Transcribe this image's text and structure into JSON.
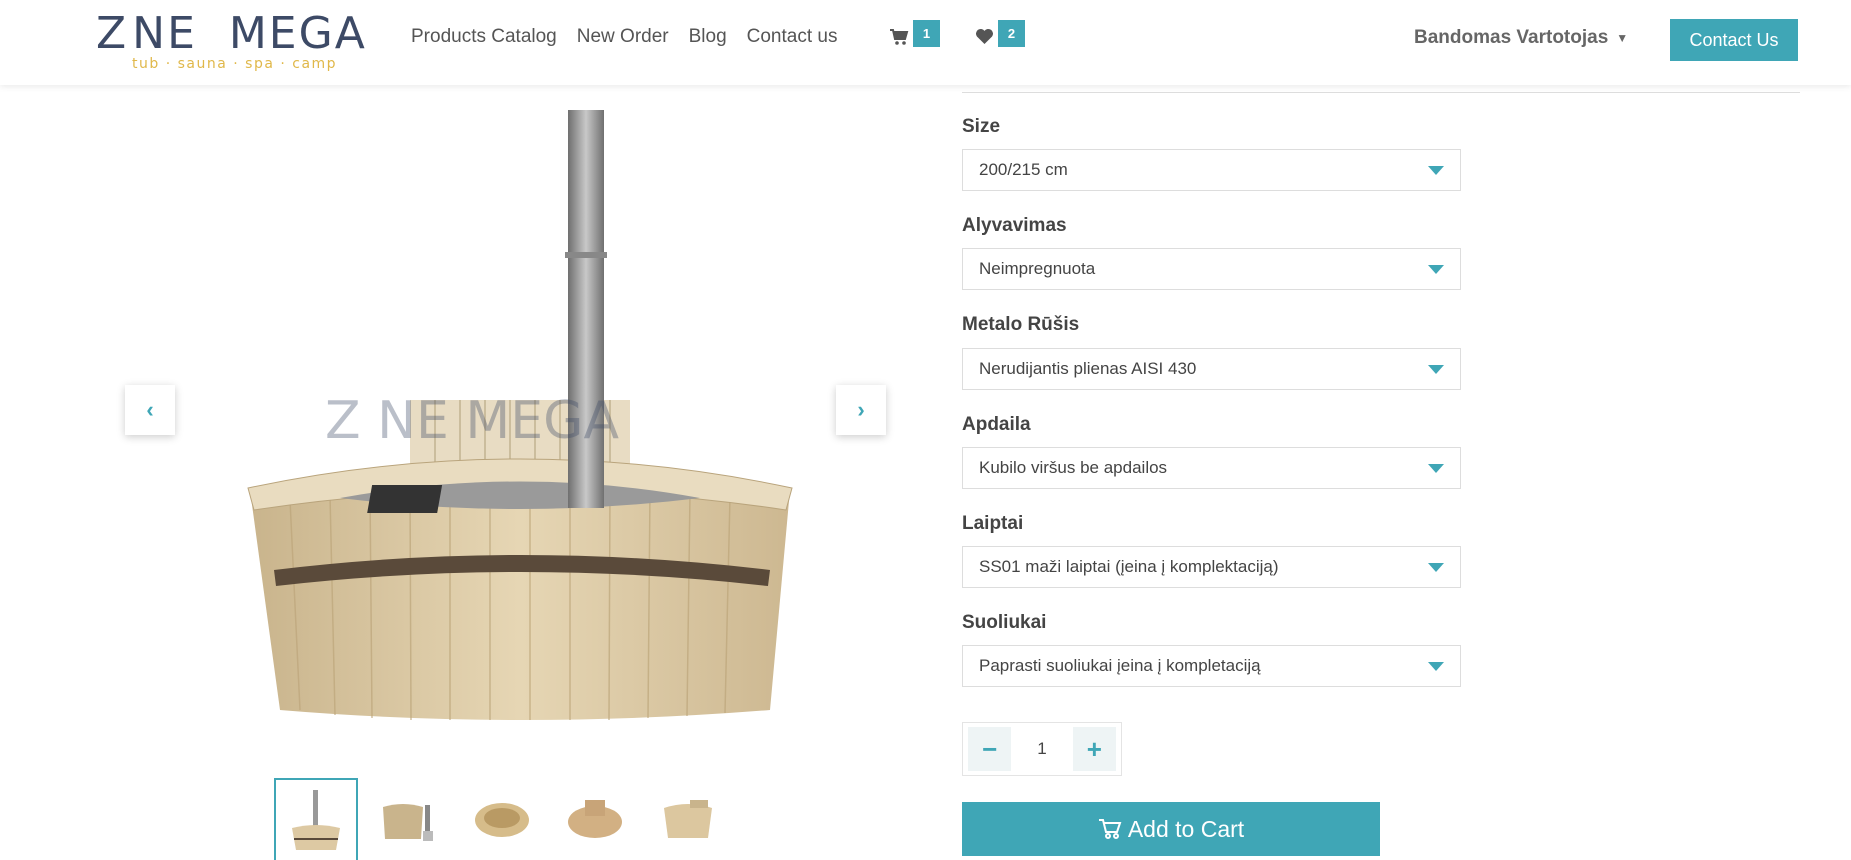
{
  "brand": {
    "logo_name": "ZONE MEGA",
    "tagline": "tub · sauna · spa · camp",
    "colors": {
      "accent": "#3fa6b6",
      "logo_text": "#3d4a66",
      "tagline": "#e0b84a"
    }
  },
  "nav": {
    "items": [
      {
        "label": "Products Catalog"
      },
      {
        "label": "New Order"
      },
      {
        "label": "Blog"
      },
      {
        "label": "Contact us"
      }
    ],
    "cart_count": "1",
    "wishlist_count": "2",
    "user_name": "Bandomas Vartotojas",
    "contact_button": "Contact Us"
  },
  "gallery": {
    "thumbnails": [
      "hot tub with stove",
      "hot tub side",
      "wooden tub open",
      "tub with bench",
      "round wooden tub"
    ]
  },
  "options": [
    {
      "label": "Size",
      "value": "200/215 cm"
    },
    {
      "label": "Alyvavimas",
      "value": "Neimpregnuota"
    },
    {
      "label": "Metalo Rūšis",
      "value": "Nerudijantis plienas AISI 430"
    },
    {
      "label": "Apdaila",
      "value": "Kubilo viršus be apdailos"
    },
    {
      "label": "Laiptai",
      "value": "SS01 maži laiptai (įeina į komplektaciją)"
    },
    {
      "label": "Suoliukai",
      "value": "Paprasti suoliukai įeina į kompletaciją"
    }
  ],
  "quantity": {
    "value": "1",
    "minus": "−",
    "plus": "+"
  },
  "add_to_cart": "Add to Cart"
}
